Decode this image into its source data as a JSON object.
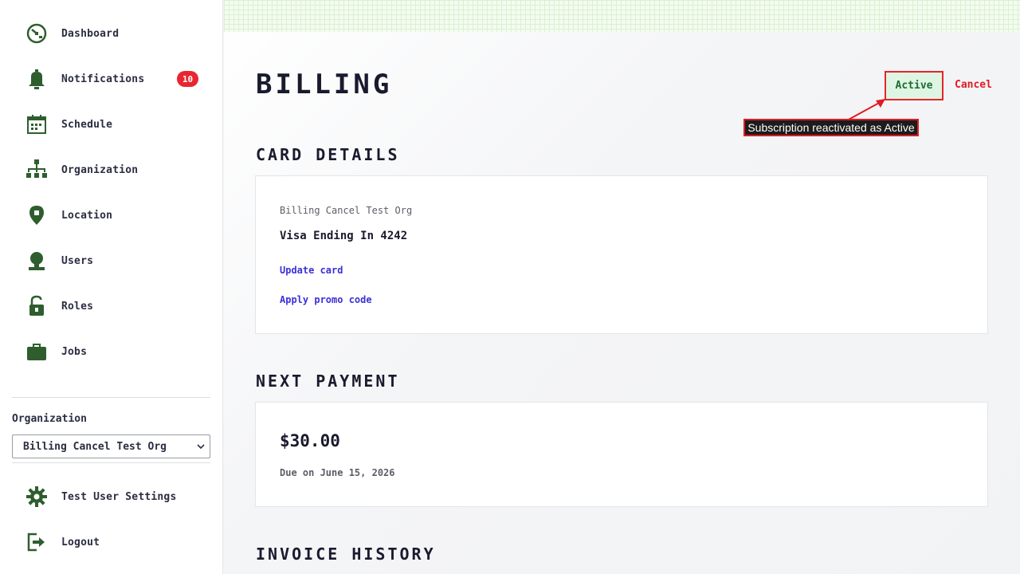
{
  "sidebar": {
    "items": [
      {
        "label": "Dashboard",
        "icon": "dashboard-icon"
      },
      {
        "label": "Notifications",
        "icon": "bell-icon",
        "badge": "10"
      },
      {
        "label": "Schedule",
        "icon": "calendar-icon"
      },
      {
        "label": "Organization",
        "icon": "org-chart-icon"
      },
      {
        "label": "Location",
        "icon": "location-pin-icon"
      },
      {
        "label": "Users",
        "icon": "user-icon"
      },
      {
        "label": "Roles",
        "icon": "padlock-icon"
      },
      {
        "label": "Jobs",
        "icon": "briefcase-icon"
      }
    ],
    "org_label": "Organization",
    "org_selected": "Billing Cancel Test Org",
    "footer": [
      {
        "label": "Test User Settings",
        "icon": "gear-icon"
      },
      {
        "label": "Logout",
        "icon": "logout-icon"
      }
    ]
  },
  "header": {
    "title": "BILLING",
    "status_button": "Active",
    "cancel_link": "Cancel",
    "callout": "Subscription reactivated as Active"
  },
  "card_details": {
    "section_title": "CARD DETAILS",
    "org_name": "Billing Cancel Test Org",
    "card_name": "Visa Ending In 4242",
    "update_link": "Update card",
    "promo_link": "Apply promo code"
  },
  "next_payment": {
    "section_title": "NEXT PAYMENT",
    "amount": "$30.00",
    "due": "Due on June 15, 2026"
  },
  "invoice_history": {
    "section_title": "INVOICE HISTORY"
  },
  "colors": {
    "icon_green": "#2e5e2e",
    "badge_red": "#e8262f",
    "link_blue": "#3b30d9",
    "cancel_red": "#e01b24",
    "active_bg": "#dff5e3"
  }
}
